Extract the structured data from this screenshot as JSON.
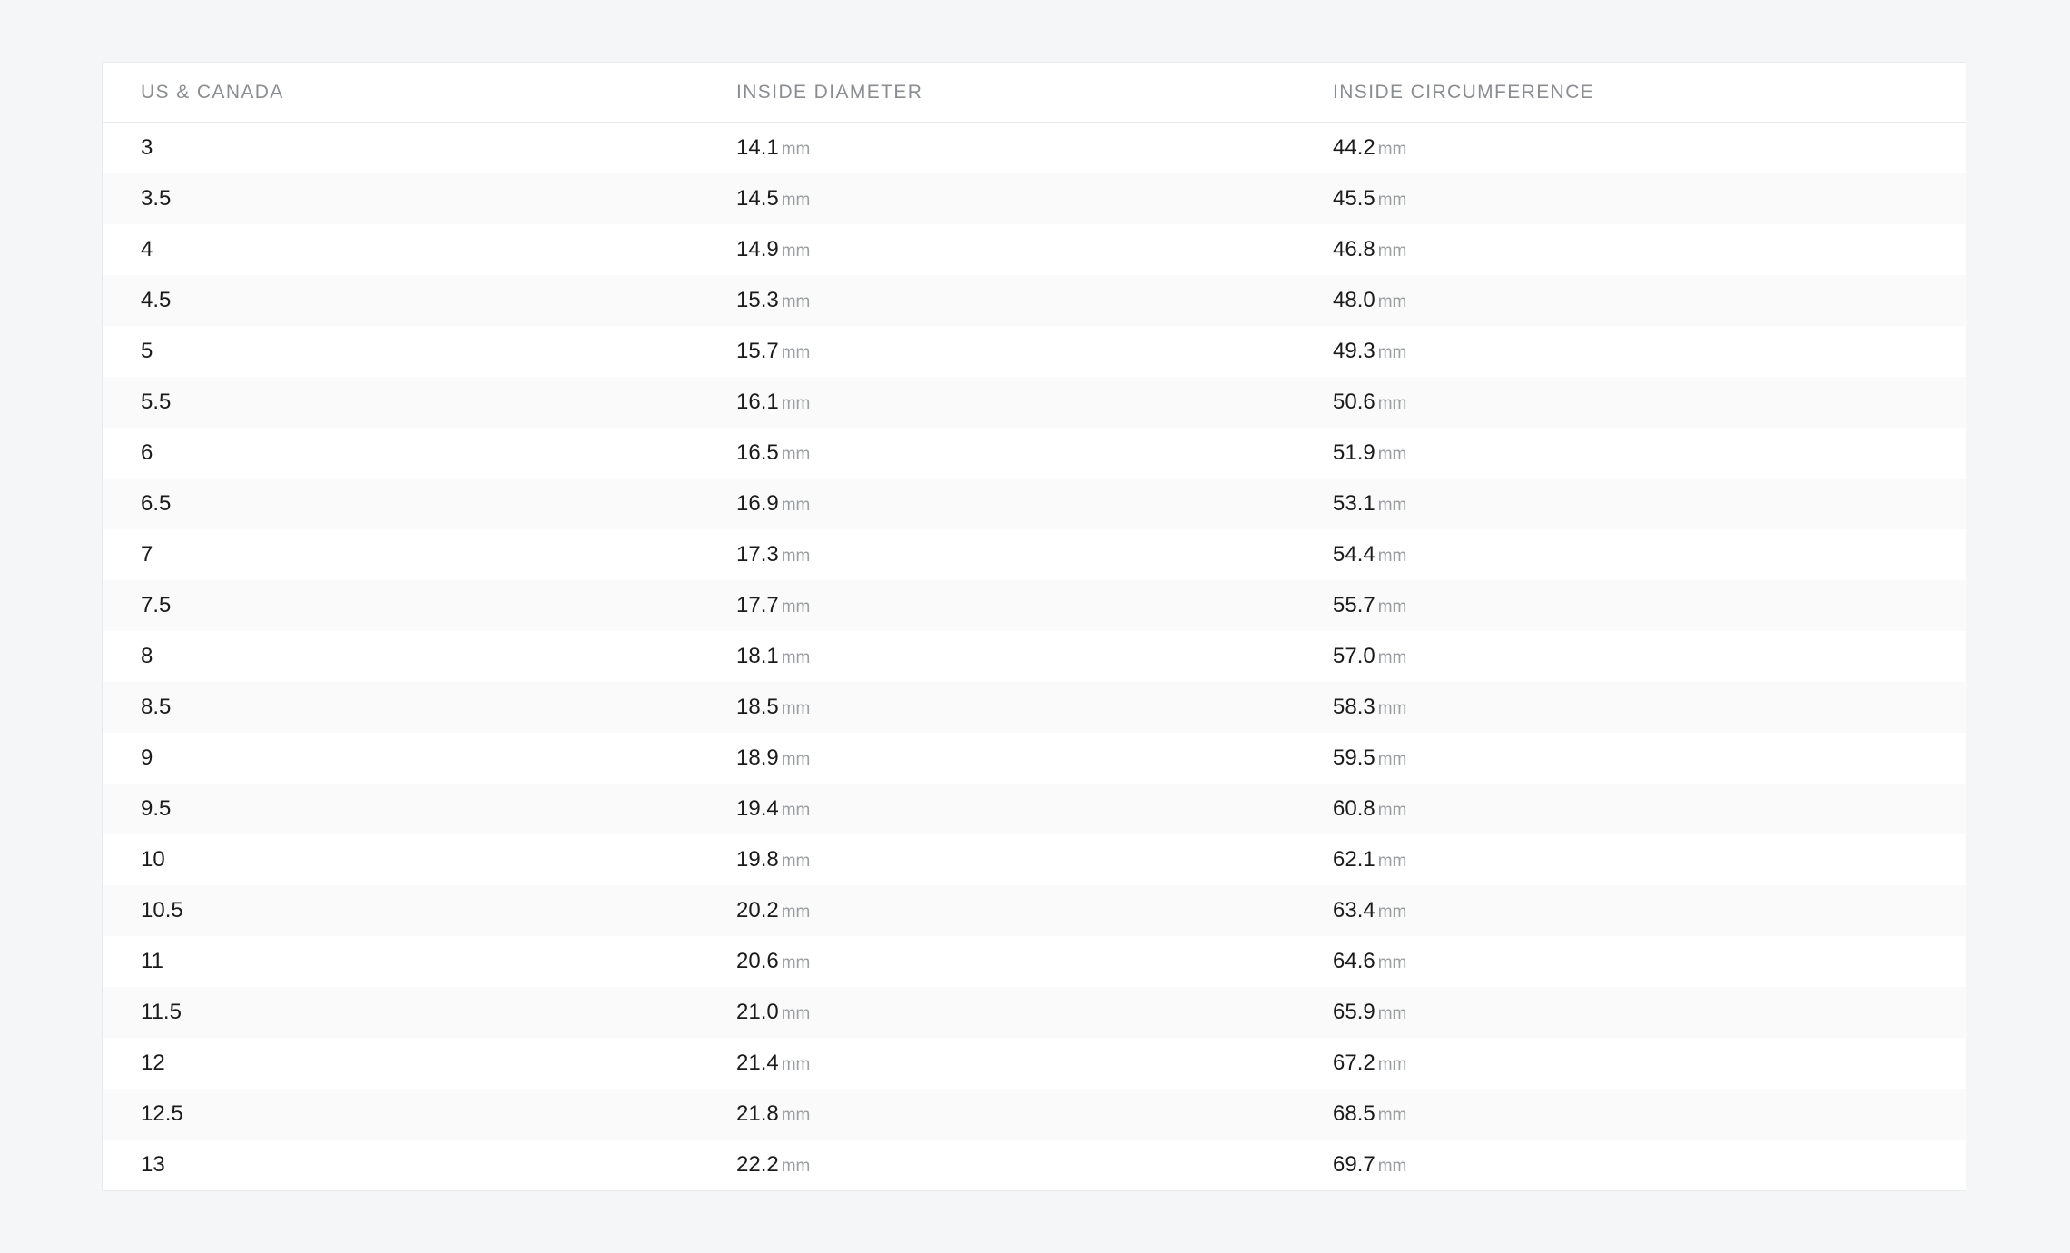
{
  "table": {
    "headers": [
      "US & CANADA",
      "INSIDE DIAMETER",
      "INSIDE CIRCUMFERENCE"
    ],
    "unit": "mm",
    "rows": [
      {
        "size": "3",
        "diameter": "14.1",
        "circumference": "44.2"
      },
      {
        "size": "3.5",
        "diameter": "14.5",
        "circumference": "45.5"
      },
      {
        "size": "4",
        "diameter": "14.9",
        "circumference": "46.8"
      },
      {
        "size": "4.5",
        "diameter": "15.3",
        "circumference": "48.0"
      },
      {
        "size": "5",
        "diameter": "15.7",
        "circumference": "49.3"
      },
      {
        "size": "5.5",
        "diameter": "16.1",
        "circumference": "50.6"
      },
      {
        "size": "6",
        "diameter": "16.5",
        "circumference": "51.9"
      },
      {
        "size": "6.5",
        "diameter": "16.9",
        "circumference": "53.1"
      },
      {
        "size": "7",
        "diameter": "17.3",
        "circumference": "54.4"
      },
      {
        "size": "7.5",
        "diameter": "17.7",
        "circumference": "55.7"
      },
      {
        "size": "8",
        "diameter": "18.1",
        "circumference": "57.0"
      },
      {
        "size": "8.5",
        "diameter": "18.5",
        "circumference": "58.3"
      },
      {
        "size": "9",
        "diameter": "18.9",
        "circumference": "59.5"
      },
      {
        "size": "9.5",
        "diameter": "19.4",
        "circumference": "60.8"
      },
      {
        "size": "10",
        "diameter": "19.8",
        "circumference": "62.1"
      },
      {
        "size": "10.5",
        "diameter": "20.2",
        "circumference": "63.4"
      },
      {
        "size": "11",
        "diameter": "20.6",
        "circumference": "64.6"
      },
      {
        "size": "11.5",
        "diameter": "21.0",
        "circumference": "65.9"
      },
      {
        "size": "12",
        "diameter": "21.4",
        "circumference": "67.2"
      },
      {
        "size": "12.5",
        "diameter": "21.8",
        "circumference": "68.5"
      },
      {
        "size": "13",
        "diameter": "22.2",
        "circumference": "69.7"
      }
    ]
  }
}
